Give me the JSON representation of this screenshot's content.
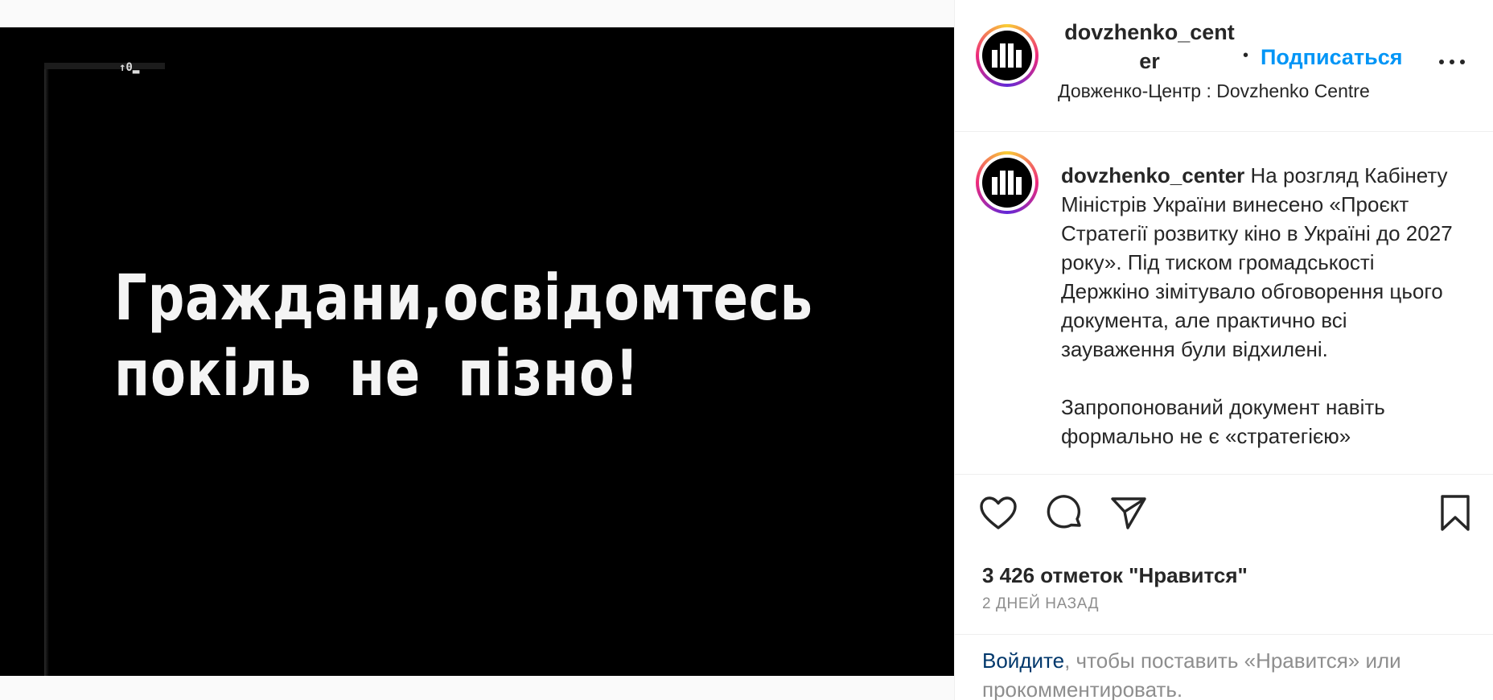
{
  "post": {
    "image": {
      "film_mark": "↑0▂",
      "title_line1": "Граждани,освідомтесь",
      "title_line2": "покіль  не  пізно!"
    }
  },
  "header": {
    "username": "dovzhenko_center",
    "separator": "•",
    "follow_label": "Подписаться",
    "location": "Довженко-Центр : Dovzhenko Centre"
  },
  "caption": {
    "username": "dovzhenko_center",
    "paragraph1": "На розгляд Кабінету Міністрів України винесено «Проєкт Стратегії розвитку кіно в Україні до 2027 року». Під тиском громадськості Держкіно зімітувало обговорення цього документа, але практично всі зауваження були відхилені.",
    "paragraph2": "Запропонований документ навіть формально не є «стратегією»"
  },
  "actions": {
    "like_icon": "heart-icon",
    "comment_icon": "comment-icon",
    "share_icon": "paper-plane-icon",
    "save_icon": "bookmark-icon"
  },
  "stats": {
    "likes": "3 426 отметок \"Нравится\"",
    "time": "2 ДНЕЙ НАЗАД"
  },
  "login": {
    "link": "Войдите",
    "text": ", чтобы поставить «Нравится» или прокомментировать."
  },
  "colors": {
    "accent": "#0095f6",
    "link_dark": "#00376b",
    "muted": "#8e8e8e"
  }
}
